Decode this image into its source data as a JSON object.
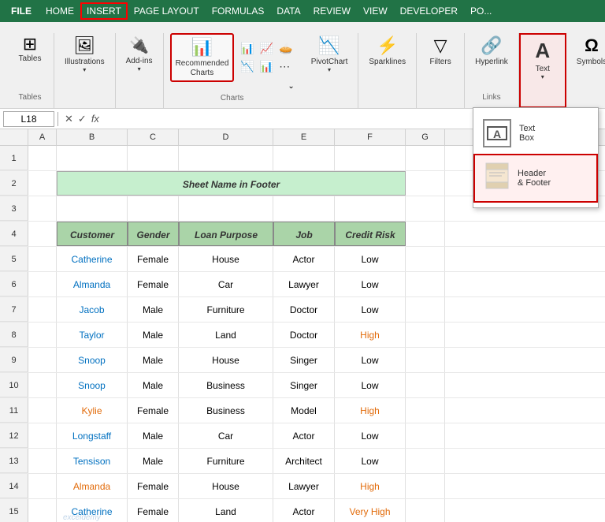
{
  "menuBar": {
    "file": "FILE",
    "items": [
      "HOME",
      "INSERT",
      "PAGE LAYOUT",
      "FORMULAS",
      "DATA",
      "REVIEW",
      "VIEW",
      "DEVELOPER",
      "PO..."
    ],
    "activeItem": "INSERT"
  },
  "ribbon": {
    "groups": [
      {
        "name": "Tables",
        "label": "Tables",
        "icon": "⊞"
      },
      {
        "name": "Illustrations",
        "label": "Illustrations",
        "icon": "🖼"
      },
      {
        "name": "Add-ins",
        "label": "Add-ins",
        "icon": "🔌"
      },
      {
        "name": "RecommendedCharts",
        "label": "Recommended\nCharts",
        "icon": "📊",
        "highlighted": true
      },
      {
        "name": "Charts",
        "label": "Charts",
        "icon": "📈"
      },
      {
        "name": "PivotChart",
        "label": "PivotChart",
        "icon": "📉"
      },
      {
        "name": "Sparklines",
        "label": "Sparklines",
        "icon": "⚡"
      },
      {
        "name": "Filters",
        "label": "Filters",
        "icon": "▽"
      },
      {
        "name": "Hyperlink",
        "label": "Hyperlink",
        "icon": "🔗"
      },
      {
        "name": "Text",
        "label": "Text",
        "icon": "A",
        "highlighted_red": true
      },
      {
        "name": "Symbols",
        "label": "Symbols",
        "icon": "Ω"
      }
    ],
    "groupLabel_charts": "Charts",
    "groupLabel_links": "Links",
    "expand_icon": "⌄"
  },
  "popup": {
    "items": [
      {
        "name": "TextBox",
        "label": "Text\nBox",
        "icon": "⬜"
      },
      {
        "name": "HeaderFooter",
        "label": "Header\n& Footer",
        "icon": "📄",
        "highlighted": true
      }
    ]
  },
  "formulaBar": {
    "cellRef": "L18",
    "formula": "fx"
  },
  "columns": [
    "A",
    "B",
    "C",
    "D",
    "E",
    "F",
    "G"
  ],
  "rows": [
    {
      "num": 1,
      "cells": [
        "",
        "",
        "",
        "",
        "",
        "",
        ""
      ]
    },
    {
      "num": 2,
      "cells": [
        "",
        "",
        "Sheet Name in Footer",
        "",
        "",
        "",
        ""
      ],
      "title": true
    },
    {
      "num": 3,
      "cells": [
        "",
        "",
        "",
        "",
        "",
        "",
        ""
      ]
    },
    {
      "num": 4,
      "cells": [
        "",
        "Customer",
        "Gender",
        "Loan Purpose",
        "Job",
        "Credit Risk",
        ""
      ],
      "header": true
    },
    {
      "num": 5,
      "cells": [
        "",
        "Catherine",
        "Female",
        "House",
        "Actor",
        "Low",
        ""
      ],
      "customerColor": "blue"
    },
    {
      "num": 6,
      "cells": [
        "",
        "Almanda",
        "Female",
        "Car",
        "Lawyer",
        "Low",
        ""
      ],
      "customerColor": "blue"
    },
    {
      "num": 7,
      "cells": [
        "",
        "Jacob",
        "Male",
        "Furniture",
        "Doctor",
        "Low",
        ""
      ],
      "customerColor": "blue"
    },
    {
      "num": 8,
      "cells": [
        "",
        "Taylor",
        "Male",
        "Land",
        "Doctor",
        "High",
        ""
      ],
      "customerColor": "blue",
      "riskColor": "orange"
    },
    {
      "num": 9,
      "cells": [
        "",
        "Snoop",
        "Male",
        "House",
        "Singer",
        "Low",
        ""
      ],
      "customerColor": "blue"
    },
    {
      "num": 10,
      "cells": [
        "",
        "Snoop",
        "Male",
        "Business",
        "Singer",
        "Low",
        ""
      ],
      "customerColor": "blue"
    },
    {
      "num": 11,
      "cells": [
        "",
        "Kylie",
        "Female",
        "Business",
        "Model",
        "High",
        ""
      ],
      "customerColor": "orange",
      "riskColor": "orange"
    },
    {
      "num": 12,
      "cells": [
        "",
        "Longstaff",
        "Male",
        "Car",
        "Actor",
        "Low",
        ""
      ],
      "customerColor": "blue"
    },
    {
      "num": 13,
      "cells": [
        "",
        "Tensison",
        "Male",
        "Furniture",
        "Architect",
        "Low",
        ""
      ],
      "customerColor": "blue"
    },
    {
      "num": 14,
      "cells": [
        "",
        "Almanda",
        "Female",
        "House",
        "Lawyer",
        "High",
        ""
      ],
      "customerColor": "orange",
      "riskColor": "orange"
    },
    {
      "num": 15,
      "cells": [
        "",
        "Catherine",
        "Female",
        "Land",
        "Actor",
        "Very High",
        ""
      ],
      "customerColor": "blue",
      "riskColor": "orange"
    }
  ],
  "watermark": "exceldemy",
  "title": "Sheet Name in Footer"
}
